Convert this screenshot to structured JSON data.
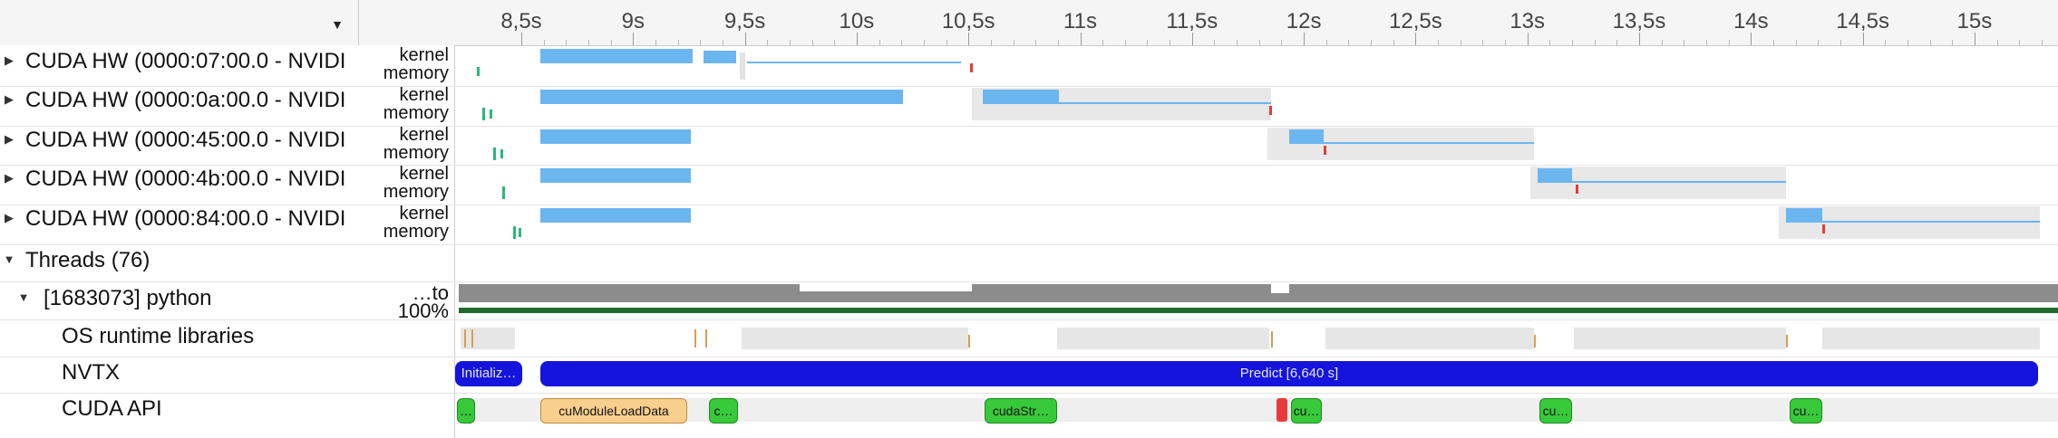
{
  "timeline": {
    "ticks": [
      "8,5s",
      "9s",
      "9,5s",
      "10s",
      "10,5s",
      "11s",
      "11,5s",
      "12s",
      "12,5s",
      "13s",
      "13,5s",
      "14s",
      "14,5s",
      "15s"
    ]
  },
  "rows": {
    "gpus": [
      {
        "label": "CUDA HW (0000:07:00.0 - NVIDI",
        "kernel": "kernel",
        "memory": "memory"
      },
      {
        "label": "CUDA HW (0000:0a:00.0 - NVIDI",
        "kernel": "kernel",
        "memory": "memory"
      },
      {
        "label": "CUDA HW (0000:45:00.0 - NVIDI",
        "kernel": "kernel",
        "memory": "memory"
      },
      {
        "label": "CUDA HW (0000:4b:00.0 - NVIDI",
        "kernel": "kernel",
        "memory": "memory"
      },
      {
        "label": "CUDA HW (0000:84:00.0 - NVIDI",
        "kernel": "kernel",
        "memory": "memory"
      }
    ],
    "threads": {
      "label": "Threads (76)"
    },
    "python": {
      "label": "[1683073] python",
      "usage": "…to 100%"
    },
    "os_runtime": {
      "label": "OS runtime libraries"
    },
    "nvtx": {
      "label": "NVTX"
    },
    "cuda_api": {
      "label": "CUDA API"
    }
  },
  "nvtx_ranges": {
    "initialize": "Initializ…",
    "predict": "Predict [6,640 s]"
  },
  "cuda_api_calls": {
    "first": "…",
    "module_load": "cuModuleLoadData",
    "c1": "c…",
    "stream": "cudaStr…",
    "cu1": "cu…",
    "cu2": "cu…",
    "cu3": "cu…"
  },
  "colors": {
    "kernel_bar": "#6cb6f0",
    "nvtx_bar": "#1414dc",
    "api_green": "#37c93a",
    "api_orange": "#f9cf8e",
    "api_red": "#e83a3a",
    "cpu_usage": "#8c8c8c",
    "cpu_usage_low": "#1f6b2e"
  },
  "icons": [
    "chevron-down-icon",
    "expand-arrow-icon",
    "collapse-arrow-icon"
  ]
}
